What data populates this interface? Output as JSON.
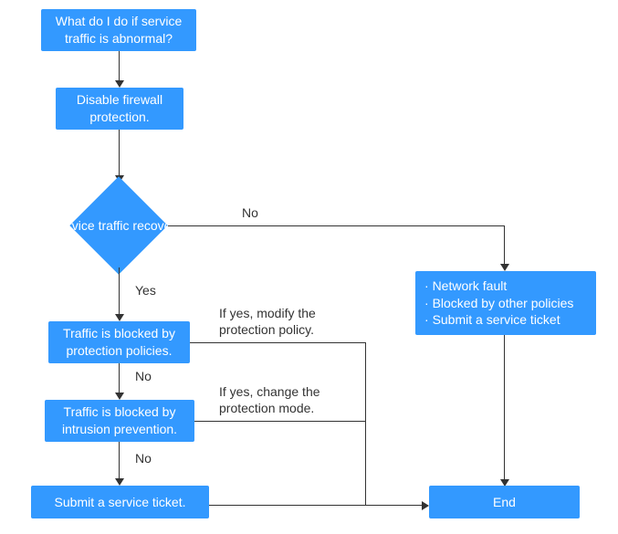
{
  "nodes": {
    "start": "What do I do if service traffic is abnormal?",
    "disable": "Disable firewall protection.",
    "decision": "Service traffic recovers.",
    "blocked_policies": "Traffic is blocked by protection policies.",
    "blocked_ips": "Traffic is blocked by intrusion prevention.",
    "submit_ticket": "Submit a service ticket.",
    "end": "End",
    "side_list": {
      "item1": "Network fault",
      "item2": "Blocked by other policies",
      "item3": "Submit a service ticket"
    }
  },
  "edges": {
    "yes": "Yes",
    "no1": "No",
    "no2": "No",
    "no3": "No",
    "modify_policy": "If yes, modify the protection policy.",
    "change_mode": "If yes, change the protection mode."
  }
}
